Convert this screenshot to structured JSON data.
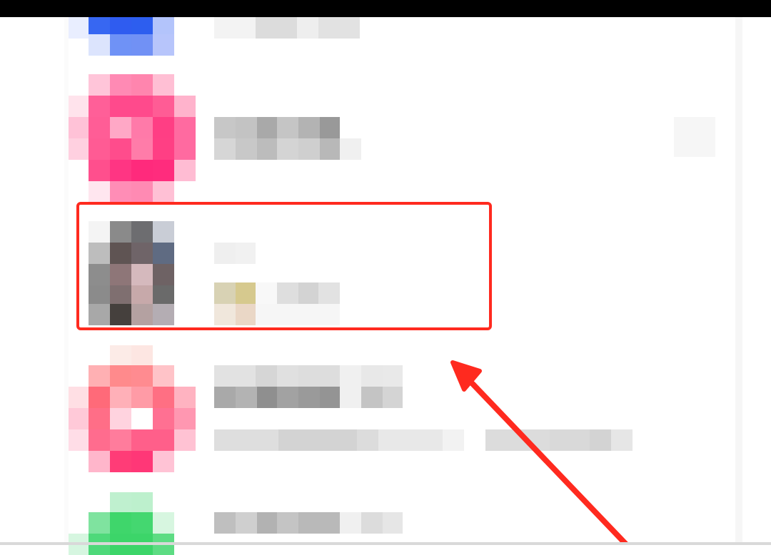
{
  "conversation_list": {
    "items": [
      {
        "id": "item-blue",
        "avatar_color": "#3a6ef0",
        "selected": false
      },
      {
        "id": "item-pink",
        "avatar_color": "#ff4f8f",
        "selected": false
      },
      {
        "id": "item-photo",
        "avatar_color": "#6b6266",
        "selected": true
      },
      {
        "id": "item-coral",
        "avatar_color": "#ff6b7a",
        "selected": false
      },
      {
        "id": "item-green",
        "avatar_color": "#3fd66b",
        "selected": false
      }
    ]
  },
  "annotation": {
    "highlight_color": "#ff2a1f",
    "arrow_color": "#ff2a1f",
    "target_item": "item-photo"
  }
}
